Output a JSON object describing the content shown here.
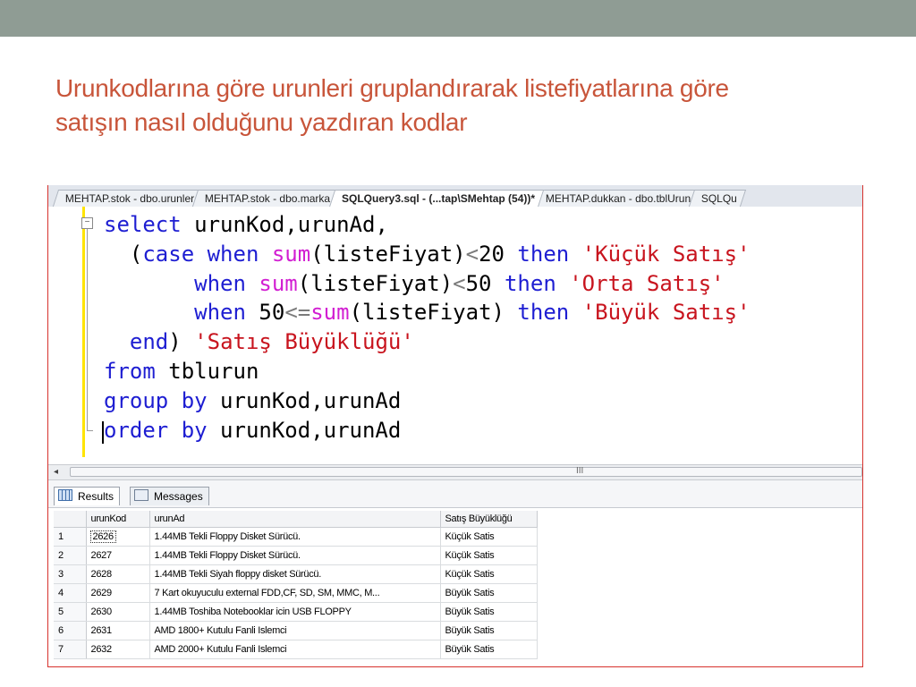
{
  "slide": {
    "title_line1": "Urunkodlarına göre urunleri gruplandırarak listefiyatlarına göre",
    "title_line2": "satışın nasıl olduğunu yazdıran kodlar",
    "topbar_color": "#8f9c94",
    "title_color": "#c8553a"
  },
  "tabs": [
    {
      "label": "MEHTAP.stok - dbo.urunler",
      "active": false
    },
    {
      "label": "MEHTAP.stok - dbo.marka",
      "active": false
    },
    {
      "label": "SQLQuery3.sql - (...tap\\SMehtap (54))*",
      "active": true
    },
    {
      "label": "MEHTAP.dukkan - dbo.tblUrun",
      "active": false
    },
    {
      "label": "SQLQu",
      "active": false
    }
  ],
  "editor": {
    "lines": [
      [
        [
          "kw",
          "select"
        ],
        [
          "t",
          " urunKod,urunAd,"
        ]
      ],
      [
        [
          "t",
          "  ("
        ],
        [
          "kw",
          "case"
        ],
        [
          "t",
          " "
        ],
        [
          "kw",
          "when"
        ],
        [
          "t",
          " "
        ],
        [
          "fn",
          "sum"
        ],
        [
          "t",
          "(listeFiyat)"
        ],
        [
          "op",
          "<"
        ],
        [
          "t",
          "20 "
        ],
        [
          "kw",
          "then"
        ],
        [
          "t",
          " "
        ],
        [
          "str",
          "'Küçük Satış'"
        ]
      ],
      [
        [
          "t",
          "       "
        ],
        [
          "kw",
          "when"
        ],
        [
          "t",
          " "
        ],
        [
          "fn",
          "sum"
        ],
        [
          "t",
          "(listeFiyat)"
        ],
        [
          "op",
          "<"
        ],
        [
          "t",
          "50 "
        ],
        [
          "kw",
          "then"
        ],
        [
          "t",
          " "
        ],
        [
          "str",
          "'Orta Satış'"
        ]
      ],
      [
        [
          "t",
          "       "
        ],
        [
          "kw",
          "when"
        ],
        [
          "t",
          " 50"
        ],
        [
          "op",
          "<="
        ],
        [
          "fn",
          "sum"
        ],
        [
          "t",
          "(listeFiyat) "
        ],
        [
          "kw",
          "then"
        ],
        [
          "t",
          " "
        ],
        [
          "str",
          "'Büyük Satış'"
        ]
      ],
      [
        [
          "t",
          "  "
        ],
        [
          "kw",
          "end"
        ],
        [
          "t",
          ") "
        ],
        [
          "str",
          "'Satış Büyüklüğü'"
        ]
      ],
      [
        [
          "kw",
          "from"
        ],
        [
          "t",
          " tblurun"
        ]
      ],
      [
        [
          "kw",
          "group by"
        ],
        [
          "t",
          " urunKod,urunAd"
        ]
      ],
      [
        [
          "kw",
          "order by"
        ],
        [
          "t",
          " urunKod,urunAd"
        ]
      ]
    ],
    "colors": {
      "keyword": "#1e1ed2",
      "function": "#d21ed2",
      "string": "#c8141e",
      "operator": "#7b7b7b"
    }
  },
  "results_tabs": {
    "results_label": "Results",
    "messages_label": "Messages"
  },
  "grid": {
    "columns": [
      "",
      "urunKod",
      "urunAd",
      "Satış Büyüklüğü"
    ],
    "rows": [
      [
        "1",
        "2626",
        "1.44MB Tekli Floppy Disket Sürücü.",
        "Küçük Satis"
      ],
      [
        "2",
        "2627",
        "1.44MB Tekli Floppy Disket Sürücü.",
        "Küçük Satis"
      ],
      [
        "3",
        "2628",
        "1.44MB Tekli Siyah floppy disket Sürücü.",
        "Küçük Satis"
      ],
      [
        "4",
        "2629",
        "7 Kart okuyuculu external FDD,CF, SD, SM, MMC, M...",
        "Büyük Satis"
      ],
      [
        "5",
        "2630",
        "1.44MB Toshiba Notebooklar icin USB FLOPPY",
        "Büyük Satis"
      ],
      [
        "6",
        "2631",
        "AMD 1800+ Kutulu Fanli Islemci",
        "Büyük Satis"
      ],
      [
        "7",
        "2632",
        "AMD 2000+ Kutulu Fanli Islemci",
        "Büyük Satis"
      ]
    ]
  },
  "scrollbar": {
    "left_arrow": "◂",
    "grip": "III"
  }
}
